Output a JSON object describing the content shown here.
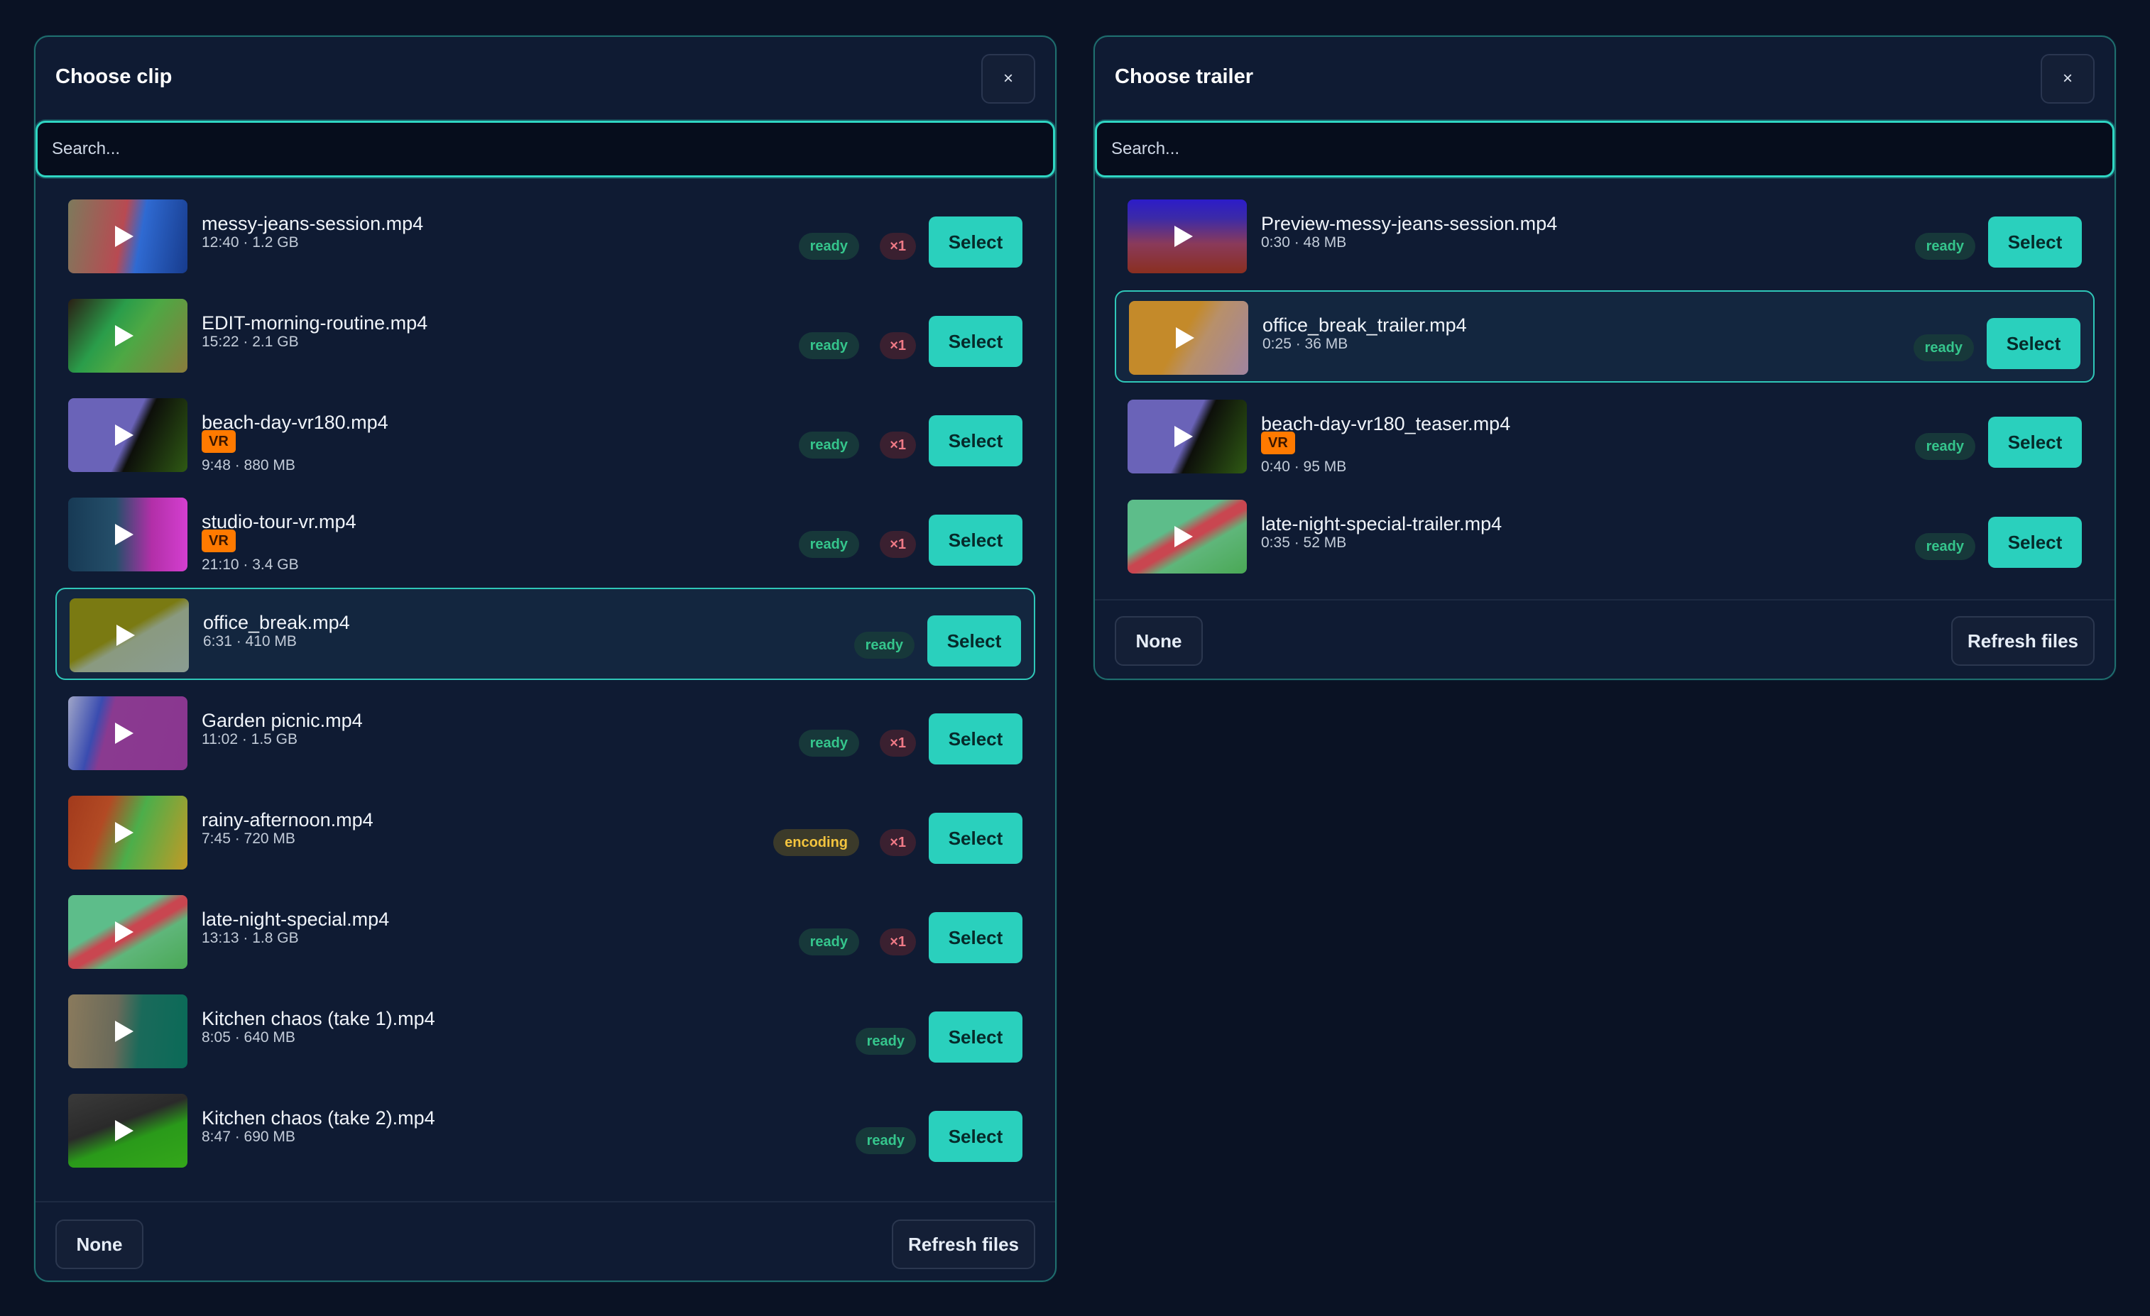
{
  "clip_dialog": {
    "title": "Choose clip",
    "close_label": "×",
    "search_placeholder": "Search...",
    "select_label": "Select",
    "none_label": "None",
    "refresh_label": "Refresh files",
    "items": [
      {
        "name": "messy-jeans-session.mp4",
        "meta": "12:40 · 1.2 GB",
        "vr": "",
        "status": "ready",
        "count": "×1",
        "thumb": "linear-gradient(100deg,#7d7a5c 0%,#b84a52 45%,#2f6ad2 60%,#173b8c 100%)"
      },
      {
        "name": "EDIT-morning-routine.mp4",
        "meta": "15:22 · 2.1 GB",
        "vr": "",
        "status": "ready",
        "count": "×1",
        "thumb": "linear-gradient(125deg,#2a1e14 0%,#2a9d4a 35%,#4da844 55%,#8a7c3c 100%)"
      },
      {
        "name": "beach-day-vr180.mp4",
        "meta": "9:48 · 880 MB",
        "vr": "VR",
        "status": "ready",
        "count": "×1",
        "thumb": "linear-gradient(115deg,#6a63b8 0%,#6a63b8 50%,#0d0f0a 58%,#2f5a14 100%)"
      },
      {
        "name": "studio-tour-vr.mp4",
        "meta": "21:10 · 3.4 GB",
        "vr": "VR",
        "status": "ready",
        "count": "×1",
        "thumb": "linear-gradient(90deg,#173a55 0%,#254f6a 40%,#b22fa8 70%,#d43fd0 100%)"
      },
      {
        "name": "office_break.mp4",
        "meta": "6:31 · 410 MB",
        "vr": "",
        "status": "ready",
        "count": "",
        "thumb": "linear-gradient(150deg,#7a7a12 0%,#7a7a12 45%,#8a9a80 55%,#8a9c92 100%)"
      },
      {
        "name": "Garden picnic.mp4",
        "meta": "11:02 · 1.5 GB",
        "vr": "",
        "status": "ready",
        "count": "×1",
        "thumb": "linear-gradient(105deg,#a0a6c8 0%,#3a4cb0 25%,#8a3a90 35%,#8a3690 100%)"
      },
      {
        "name": "rainy-afternoon.mp4",
        "meta": "7:45 · 720 MB",
        "vr": "",
        "status": "encoding",
        "count": "×1",
        "thumb": "linear-gradient(110deg,#a23a1c 0%,#b24a24 30%,#4cae4a 55%,#c29a26 100%)"
      },
      {
        "name": "late-night-special.mp4",
        "meta": "13:13 · 1.8 GB",
        "vr": "",
        "status": "ready",
        "count": "×1",
        "thumb": "linear-gradient(150deg,#5dbd8a 0%,#5dbd8a 38%,#c94650 48%,#c94650 54%,#5fb67a 64%,#4aa855 100%)"
      },
      {
        "name": "Kitchen chaos (take 1).mp4",
        "meta": "8:05 · 640 MB",
        "vr": "",
        "status": "ready",
        "count": "",
        "thumb": "linear-gradient(95deg,#8a7a5c 0%,#6a6a5a 40%,#1a6a5a 60%,#0a6a58 100%)"
      },
      {
        "name": "Kitchen chaos (take 2).mp4",
        "meta": "8:47 · 690 MB",
        "vr": "",
        "status": "ready",
        "count": "",
        "thumb": "linear-gradient(160deg,#3a3a3a 0%,#2a2a2a 40%,#2a9a1a 60%,#34a71a 100%)"
      }
    ]
  },
  "trailer_dialog": {
    "title": "Choose trailer",
    "close_label": "×",
    "search_placeholder": "Search...",
    "select_label": "Select",
    "none_label": "None",
    "refresh_label": "Refresh files",
    "items": [
      {
        "name": "Preview-messy-jeans-session.mp4",
        "meta": "0:30 · 48 MB",
        "vr": "",
        "status": "ready",
        "count": "",
        "thumb": "linear-gradient(180deg,#2c1cc8 0%,#3b2aa8 25%,#8a3a5a 60%,#8a2f20 100%)"
      },
      {
        "name": "office_break_trailer.mp4",
        "meta": "0:25 · 36 MB",
        "vr": "",
        "status": "ready",
        "count": "",
        "thumb": "linear-gradient(120deg,#c48a2a 0%,#c48a2a 45%,#b8906a 60%,#a084a0 100%)"
      },
      {
        "name": "beach-day-vr180_teaser.mp4",
        "meta": "0:40 · 95 MB",
        "vr": "VR",
        "status": "ready",
        "count": "",
        "thumb": "linear-gradient(115deg,#6a63b8 0%,#6a63b8 50%,#0d0f0a 58%,#2f5a14 100%)"
      },
      {
        "name": "late-night-special-trailer.mp4",
        "meta": "0:35 · 52 MB",
        "vr": "",
        "status": "ready",
        "count": "",
        "thumb": "linear-gradient(150deg,#5dbd8a 0%,#5dbd8a 38%,#c94650 48%,#c94650 54%,#5fb67a 64%,#4aa855 100%)"
      }
    ]
  },
  "colors": {
    "accent": "#2ad0bd",
    "panel_bg": "#0f1b33",
    "page_bg": "#0a1224",
    "ready_text": "#35c58c",
    "encoding_text": "#f3c43e",
    "count_text": "#f07a86",
    "vr_badge": "#ff7a00"
  },
  "icons": {
    "play": "play-icon",
    "close": "close-icon"
  }
}
